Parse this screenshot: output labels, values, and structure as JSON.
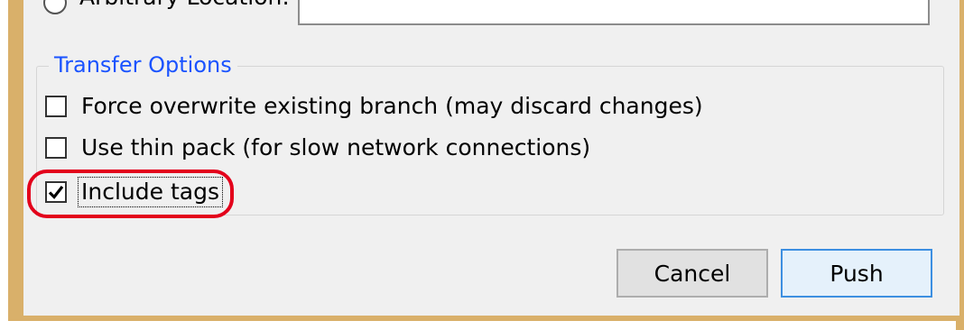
{
  "location": {
    "radio_label": "Arbitrary Location:",
    "input_value": ""
  },
  "transfer_options": {
    "title": "Transfer Options",
    "options": [
      {
        "label": "Force overwrite existing branch (may discard changes)",
        "checked": false
      },
      {
        "label": "Use thin pack (for slow network connections)",
        "checked": false
      },
      {
        "label": "Include tags",
        "checked": true
      }
    ]
  },
  "buttons": {
    "cancel_label": "Cancel",
    "push_label": "Push"
  },
  "colors": {
    "group_title": "#1a53ff",
    "highlight": "#e3001b",
    "window_frame": "#d9b06a",
    "default_button_border": "#3c8fe1"
  },
  "icons": {
    "check": "check-icon"
  }
}
